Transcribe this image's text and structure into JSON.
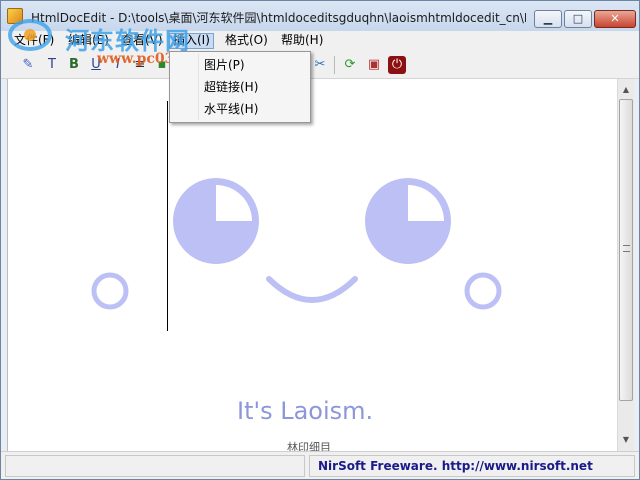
{
  "window": {
    "title": "HtmlDocEdit - D:\\tools\\桌面\\河东软件园\\htmldoceditsgduqhn\\laoismhtmldocedit_cn\\L...",
    "min_label": "▁",
    "max_label": "□",
    "close_label": "✕"
  },
  "watermark": {
    "text": "河东软件网",
    "url": "www.pc0359.cn"
  },
  "menubar": {
    "items": [
      "文件(F)",
      "编辑(E)",
      "查看(V)",
      "插入(I)",
      "格式(O)",
      "帮助(H)"
    ]
  },
  "toolbar": {
    "items": [
      {
        "name": "format-icon",
        "glyph": "✎",
        "color": "#3b5fc4"
      },
      {
        "name": "font-icon",
        "glyph": "T",
        "color": "#2a3f8f"
      },
      {
        "name": "bold-icon",
        "glyph": "B",
        "color": "#2a6a2a"
      },
      {
        "name": "underline-icon",
        "glyph": "U",
        "color": "#2a3f8f"
      },
      {
        "name": "italic-icon",
        "glyph": "I",
        "color": "#2a3f8f"
      },
      {
        "name": "list-icon",
        "glyph": "≡",
        "color": "#333333"
      },
      {
        "name": "bullet-icon",
        "glyph": "▪",
        "color": "#2a8a2a"
      },
      {
        "name": "cut-icon",
        "glyph": "✂",
        "color": "#2a6fbf"
      },
      {
        "name": "refresh-icon",
        "glyph": "⟳",
        "color": "#2a9a2a"
      },
      {
        "name": "save-icon",
        "glyph": "▣",
        "color": "#b03030"
      },
      {
        "name": "power-icon",
        "glyph": "⏻",
        "color": "#ffffff"
      }
    ]
  },
  "insert_menu": {
    "items": [
      "图片(P)",
      "超链接(H)",
      "水平线(H)"
    ]
  },
  "document": {
    "slogan": "It's Laoism.",
    "footer": "林印细目",
    "face_color": "#bcc0f5"
  },
  "statusbar": {
    "left": "",
    "right": "NirSoft Freeware.  http://www.nirsoft.net"
  }
}
